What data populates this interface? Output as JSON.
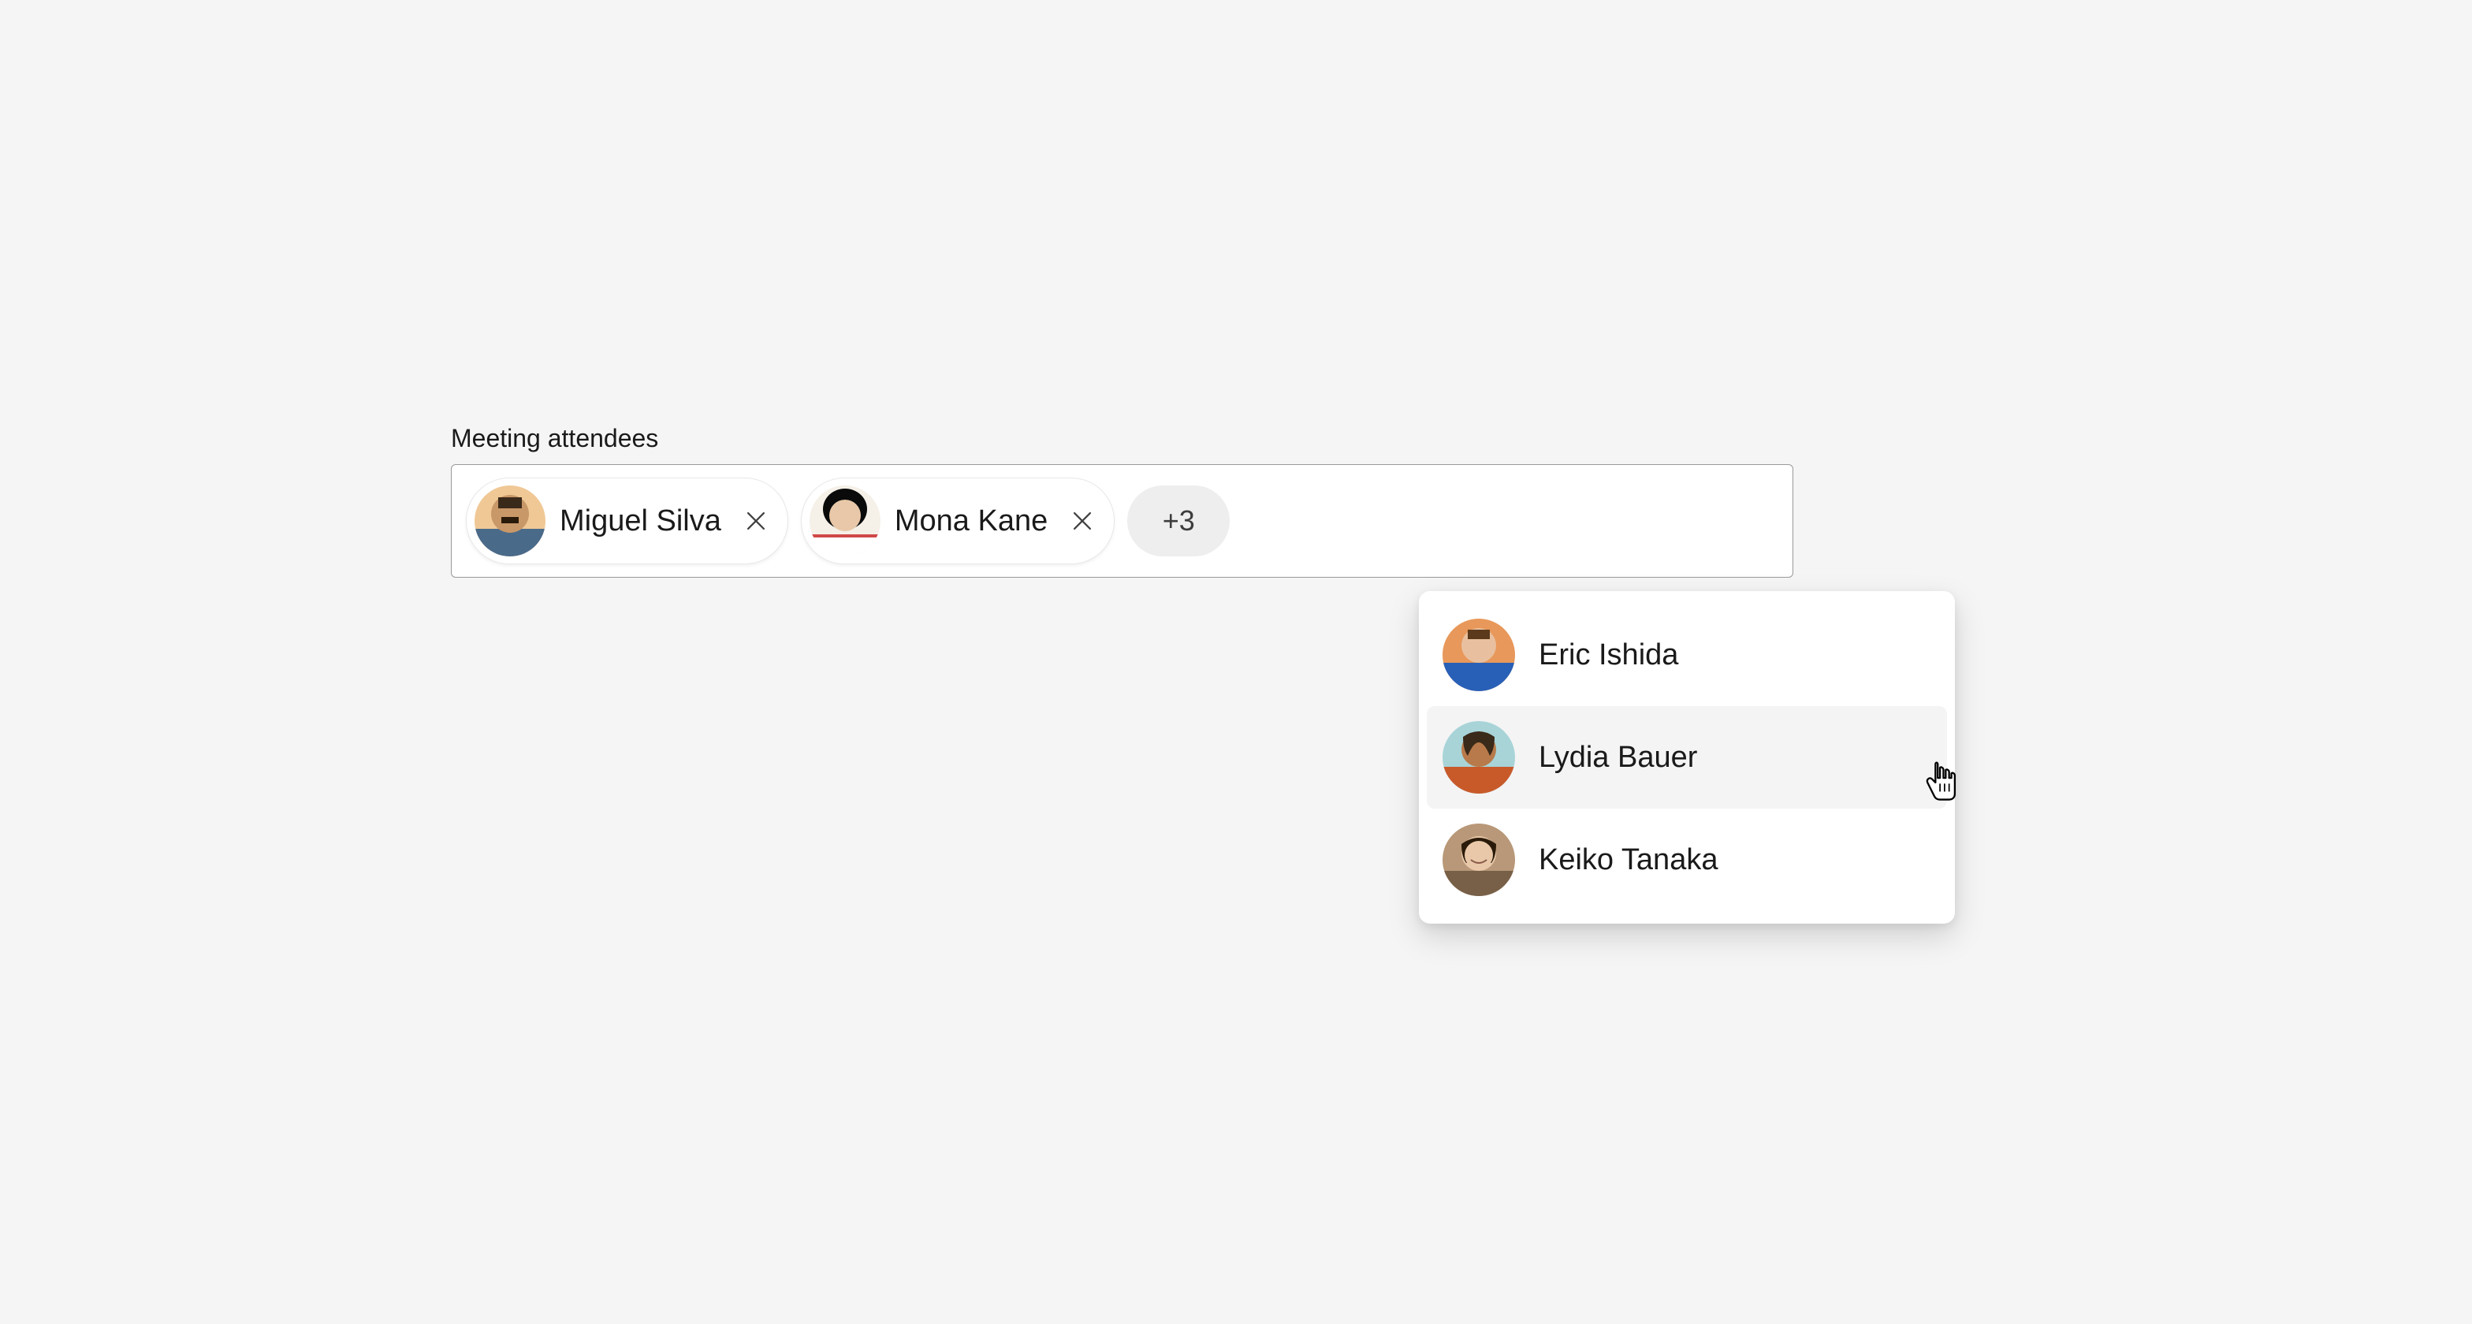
{
  "label": "Meeting attendees",
  "chips": [
    {
      "name": "Miguel Silva",
      "avatar_bg1": "#d9b896",
      "avatar_bg2": "#8a6543"
    },
    {
      "name": "Mona Kane",
      "avatar_bg1": "#1a1a1a",
      "avatar_bg2": "#f0d0b0"
    }
  ],
  "overflow_label": "+3",
  "dropdown": [
    {
      "name": "Eric Ishida",
      "avatar_bg1": "#e67e22",
      "avatar_bg2": "#2c5aa0",
      "hovered": false
    },
    {
      "name": "Lydia Bauer",
      "avatar_bg1": "#b8d4d0",
      "avatar_bg2": "#8b5a3c",
      "hovered": true
    },
    {
      "name": "Keiko Tanaka",
      "avatar_bg1": "#a8886a",
      "avatar_bg2": "#d4b896",
      "hovered": false
    }
  ]
}
